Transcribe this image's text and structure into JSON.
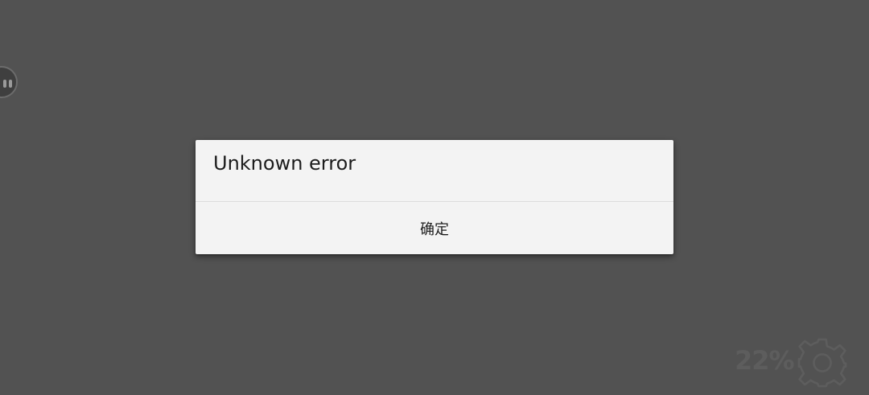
{
  "dialog": {
    "message": "Unknown error",
    "confirm_label": "确定"
  },
  "status": {
    "battery": "22%"
  },
  "icons": {
    "floating": "floating-assistant-icon",
    "settings": "gear-icon"
  },
  "colors": {
    "background": "#525252",
    "dialog_bg": "#f3f3f3",
    "text": "#1c1c1c"
  }
}
